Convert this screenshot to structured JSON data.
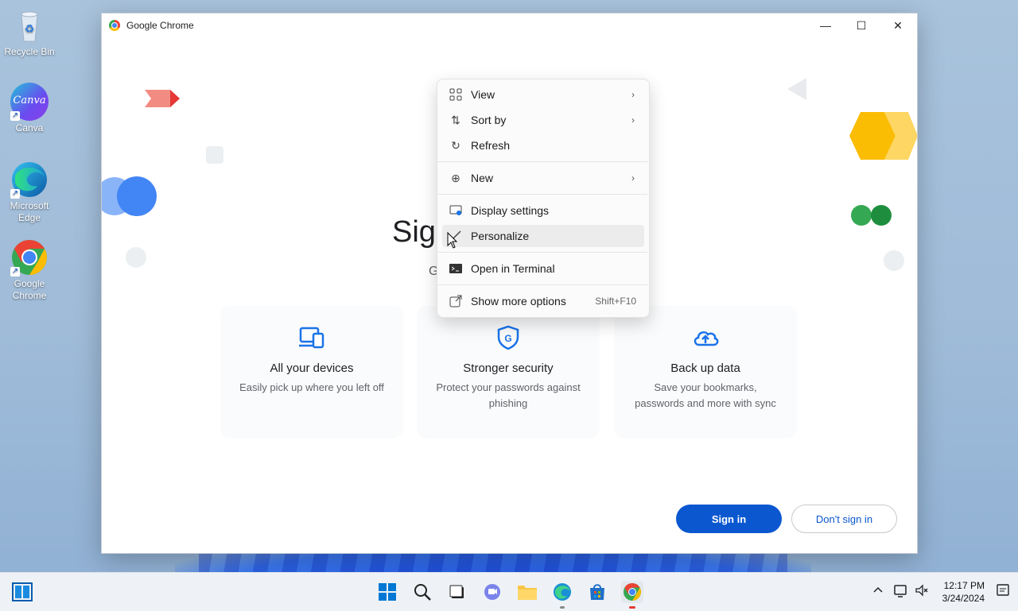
{
  "desktop": {
    "icons": [
      {
        "label": "Recycle Bin"
      },
      {
        "label": "Canva"
      },
      {
        "label": "Microsoft Edge"
      },
      {
        "label": "Google Chrome"
      }
    ],
    "canva_logo_text": "Canva"
  },
  "window": {
    "title": "Google Chrome",
    "heading_partial": "Sig",
    "sub_partial": "G"
  },
  "features": [
    {
      "icon": "devices-icon",
      "title": "All your devices",
      "desc": "Easily pick up where you left off"
    },
    {
      "icon": "shield-g-icon",
      "title": "Stronger security",
      "desc": "Protect your passwords against phishing"
    },
    {
      "icon": "cloud-upload-icon",
      "title": "Back up data",
      "desc": "Save your bookmarks, passwords and more with sync"
    }
  ],
  "buttons": {
    "sign_in": "Sign in",
    "dont_sign_in": "Don't sign in"
  },
  "context_menu": {
    "items": [
      {
        "label": "View",
        "icon": "grid-icon",
        "submenu": true
      },
      {
        "label": "Sort by",
        "icon": "sort-icon",
        "submenu": true
      },
      {
        "label": "Refresh",
        "icon": "refresh-icon",
        "submenu": false
      },
      {
        "label": "New",
        "icon": "plus-circle-icon",
        "submenu": true
      },
      {
        "label": "Display settings",
        "icon": "display-icon",
        "submenu": false
      },
      {
        "label": "Personalize",
        "icon": "brush-icon",
        "submenu": false,
        "highlighted": true
      },
      {
        "label": "Open in Terminal",
        "icon": "terminal-icon",
        "submenu": false
      },
      {
        "label": "Show more options",
        "icon": "external-icon",
        "shortcut": "Shift+F10"
      }
    ]
  },
  "taskbar": {
    "time": "12:17 PM",
    "date": "3/24/2024"
  },
  "colors": {
    "accent": "#0b57d0",
    "icon_blue": "#1a73e8"
  }
}
